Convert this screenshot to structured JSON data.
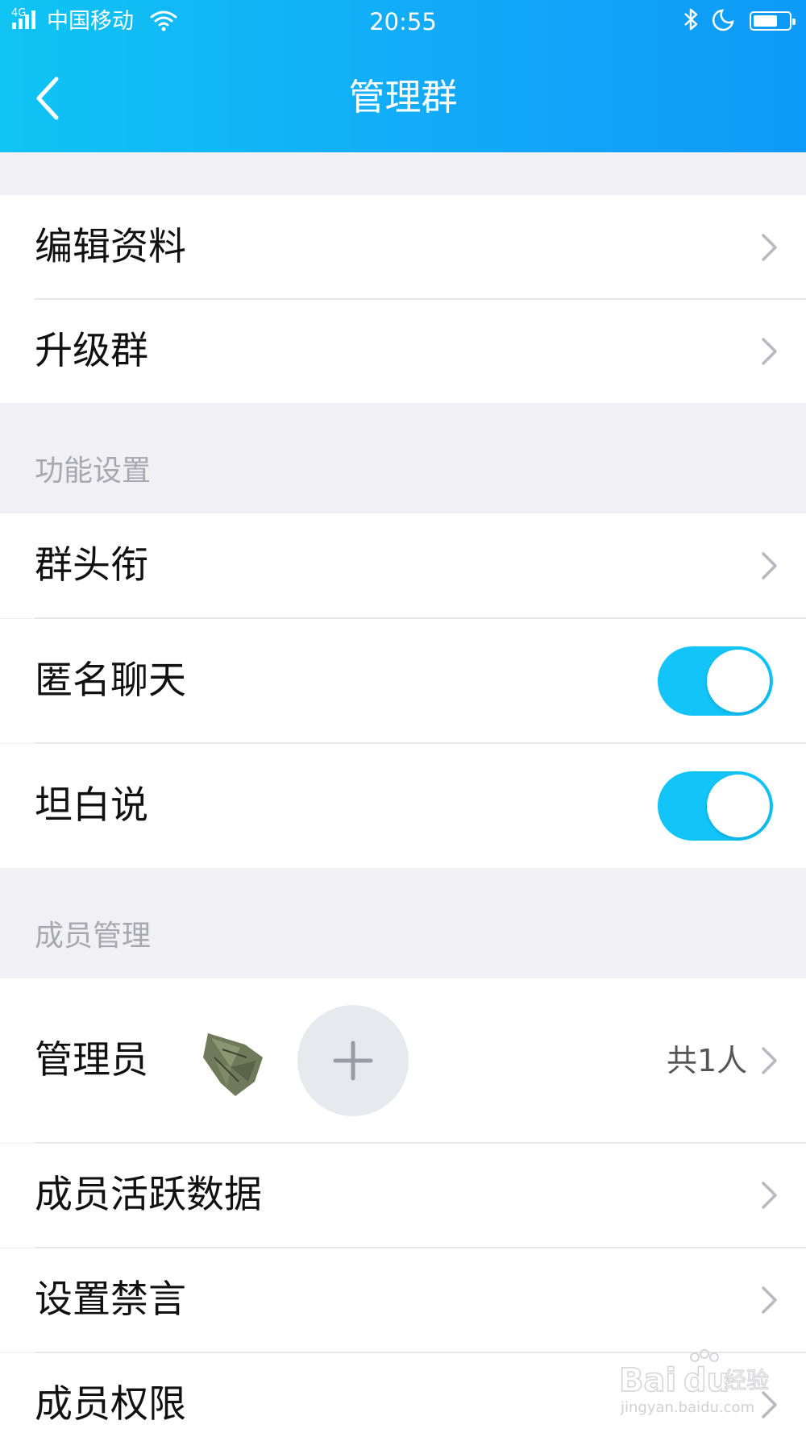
{
  "status_bar": {
    "network": "4G",
    "carrier": "中国移动",
    "time": "20:55",
    "icons": [
      "signal-icon",
      "wifi-icon",
      "bluetooth-icon",
      "moon-icon",
      "battery-icon"
    ]
  },
  "nav": {
    "title": "管理群",
    "back_icon": "chevron-left-icon"
  },
  "group1": [
    {
      "label": "编辑资料"
    },
    {
      "label": "升级群"
    }
  ],
  "sections": {
    "features": {
      "title": "功能设置",
      "items": [
        {
          "label": "群头衔"
        },
        {
          "label": "匿名聊天",
          "toggle_on": true
        },
        {
          "label": "坦白说",
          "toggle_on": true
        }
      ]
    },
    "members": {
      "title": "成员管理",
      "admin": {
        "label": "管理员",
        "count": "共1人"
      },
      "items": [
        {
          "label": "成员活跃数据"
        },
        {
          "label": "设置禁言"
        },
        {
          "label": "成员权限"
        }
      ]
    }
  },
  "colors": {
    "header_start": "#10c4f4",
    "header_end": "#0e9af8",
    "toggle_on": "#12c4f8",
    "background": "#f0f0f5"
  },
  "watermark": {
    "brand": "Bai",
    "brand2": "du",
    "cn": "经验",
    "url": "jingyan.baidu.com"
  }
}
